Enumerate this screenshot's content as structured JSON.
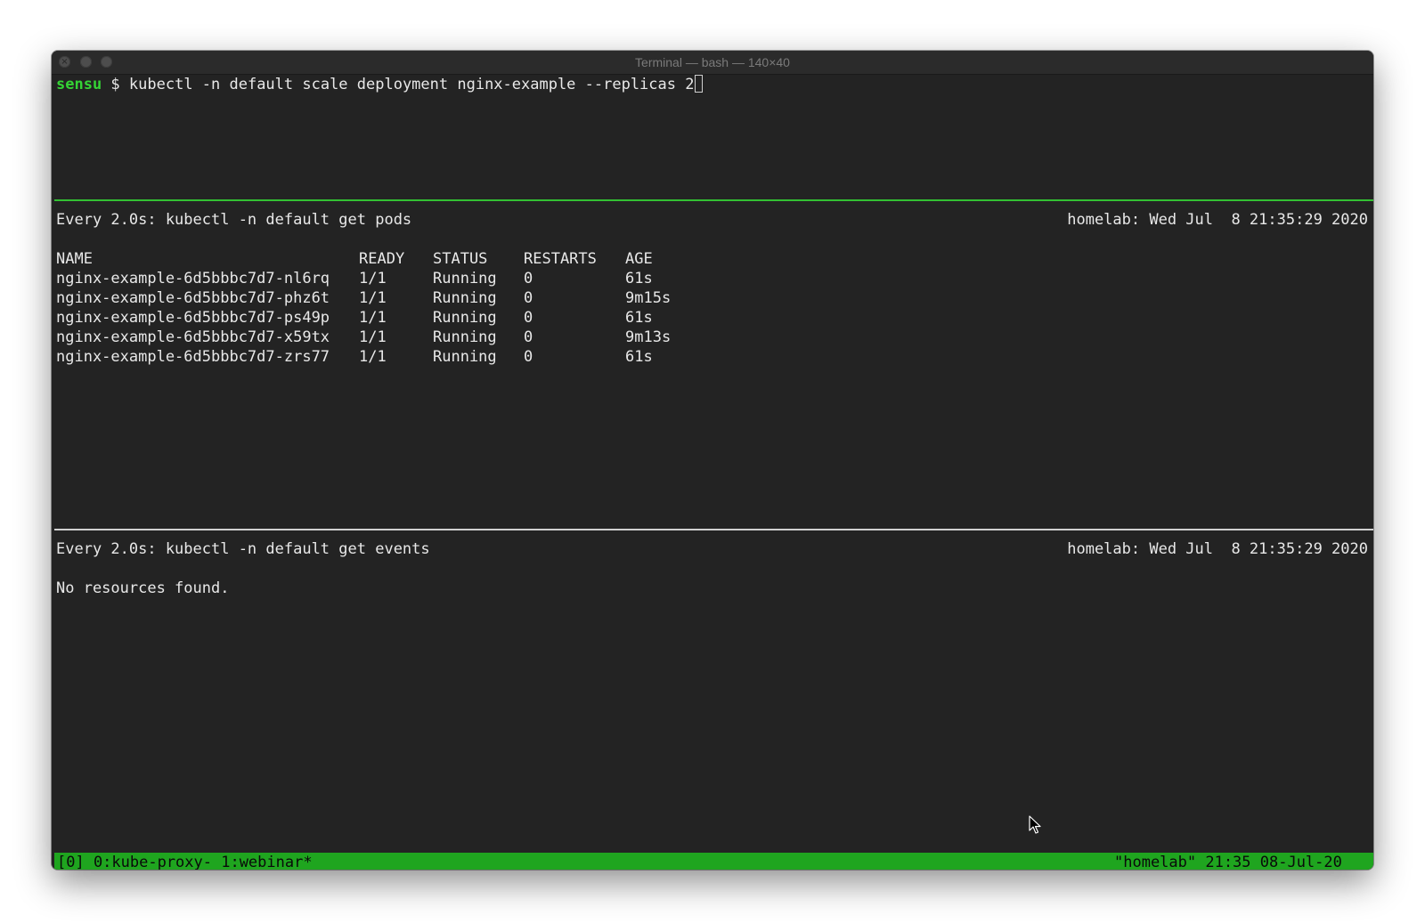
{
  "window": {
    "title": "Terminal — bash — 140×40"
  },
  "prompt": {
    "user": "sensu",
    "symbol": " $ ",
    "command": "kubectl -n default scale deployment nginx-example --replicas 2"
  },
  "pods_pane": {
    "header_left": "Every 2.0s: kubectl -n default get pods",
    "header_right": "homelab: Wed Jul  8 21:35:29 2020",
    "columns": [
      "NAME",
      "READY",
      "STATUS",
      "RESTARTS",
      "AGE"
    ],
    "rows": [
      [
        "nginx-example-6d5bbbc7d7-nl6rq",
        "1/1",
        "Running",
        "0",
        "61s"
      ],
      [
        "nginx-example-6d5bbbc7d7-phz6t",
        "1/1",
        "Running",
        "0",
        "9m15s"
      ],
      [
        "nginx-example-6d5bbbc7d7-ps49p",
        "1/1",
        "Running",
        "0",
        "61s"
      ],
      [
        "nginx-example-6d5bbbc7d7-x59tx",
        "1/1",
        "Running",
        "0",
        "9m13s"
      ],
      [
        "nginx-example-6d5bbbc7d7-zrs77",
        "1/1",
        "Running",
        "0",
        "61s"
      ]
    ]
  },
  "events_pane": {
    "header_left": "Every 2.0s: kubectl -n default get events",
    "header_right": "homelab: Wed Jul  8 21:35:29 2020",
    "message": "No resources found."
  },
  "statusbar": {
    "left": "[0] 0:kube-proxy- 1:webinar*",
    "right": "\"homelab\" 21:35 08-Jul-20"
  },
  "colors": {
    "prompt_user": "#35d435",
    "statusbar_bg": "#1fa51f",
    "active_divider": "#33c033"
  }
}
